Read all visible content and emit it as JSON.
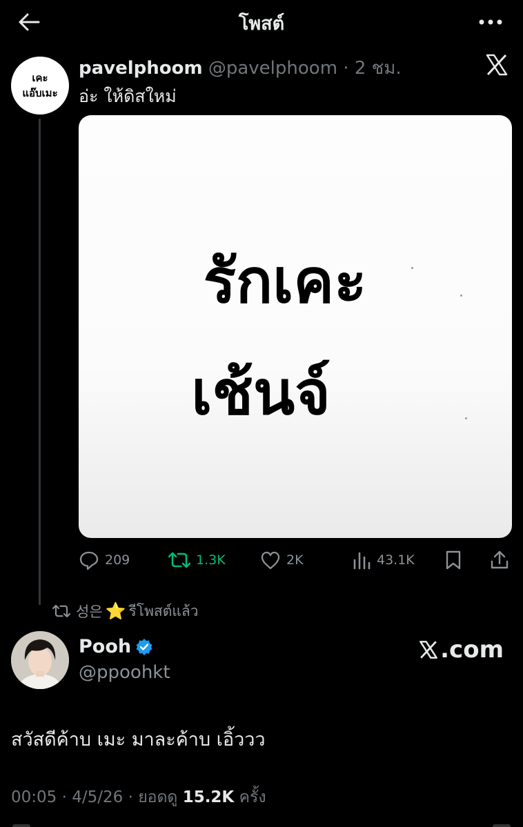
{
  "topbar": {
    "title": "โพสต์"
  },
  "post1": {
    "avatar_line1": "เคะ",
    "avatar_line2": "แอ๊บเมะ",
    "name": "pavelphoom",
    "handle": "@pavelphoom",
    "separator": " · ",
    "time": "2 ชม.",
    "text": "อ่ะ ให้ดิสใหม่",
    "image_line1": "รักเคะ",
    "image_line2": "เช้นจ์",
    "replies": "209",
    "reposts": "1.3K",
    "likes": "2K",
    "views": "43.1K"
  },
  "repost": {
    "user": "성은",
    "star": "⭐",
    "label": "รีโพสต์แล้ว"
  },
  "post2": {
    "name": "Pooh",
    "handle": "@ppoohkt",
    "brand": ".com",
    "text": "สวัสดีค้าบ เมะ มาละค้าบ เอิ้ววว",
    "time": "00:05",
    "sep1": " · ",
    "date": "4/5/26",
    "sep2": " · ",
    "views_label": "ยอดดู ",
    "views": "15.2K",
    "views_suffix": " ครั้ง"
  },
  "colors": {
    "bg": "#000000",
    "text": "#e7e9ea",
    "muted": "#71767b",
    "retweet": "#00ba7c",
    "verified": "#1d9bf0"
  },
  "icons": [
    "back-arrow-icon",
    "more-icon",
    "x-logo-icon",
    "reply-icon",
    "retweet-icon",
    "like-icon",
    "views-icon",
    "bookmark-icon",
    "share-icon",
    "verified-badge-icon"
  ]
}
